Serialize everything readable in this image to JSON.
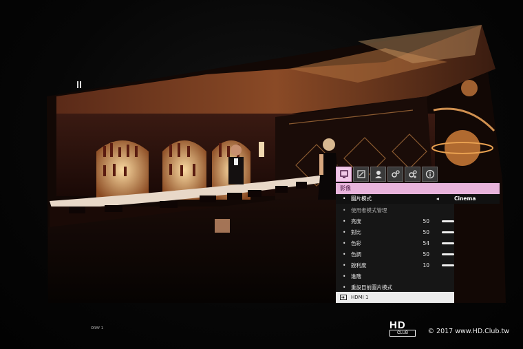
{
  "osd": {
    "header_title": "影像",
    "picture_mode_label": "圖片模式",
    "picture_mode_arrow": "◂",
    "picture_mode_value": "Cinema",
    "user_mode_label": "使用者模式管理",
    "items": [
      {
        "label": "亮度",
        "value": "50"
      },
      {
        "label": "對比",
        "value": "50"
      },
      {
        "label": "色彩",
        "value": "54"
      },
      {
        "label": "色調",
        "value": "50"
      },
      {
        "label": "銳利度",
        "value": "10"
      },
      {
        "label": "進階",
        "value": ""
      },
      {
        "label": "重設目前圖片模式",
        "value": ""
      }
    ],
    "source_label": "HDMI 1",
    "bullet": "•"
  },
  "watermark": {
    "logo_hd": "HD",
    "logo_club": "CLUB",
    "text": "© 2017 www.HD.Club.tw"
  },
  "device_label": "ORAY 1"
}
